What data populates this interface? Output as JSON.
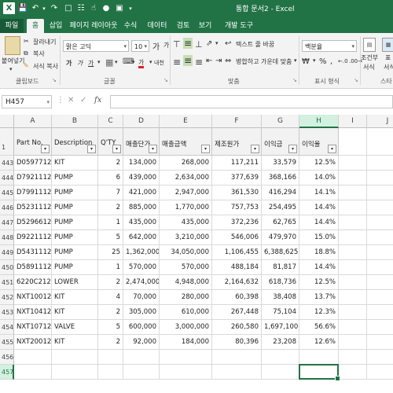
{
  "app": {
    "title": "통합 문서2 - Excel",
    "logo": "X",
    "accent": "#217346",
    "quick_access_icons": [
      "save-icon",
      "undo-icon",
      "redo-icon",
      "new-file-icon",
      "print-preview-icon",
      "touch-mode-icon",
      "color-icon",
      "camera-icon",
      "more-icon"
    ]
  },
  "tabs": [
    "파일",
    "홈",
    "삽입",
    "페이지 레이아웃",
    "수식",
    "데이터",
    "검토",
    "보기",
    "개발 도구"
  ],
  "active_tab": "홈",
  "ribbon": {
    "clipboard": {
      "paste": "붙여넣기",
      "cut": "잘라내기",
      "copy": "복사",
      "format_painter": "서식 복사",
      "group": "클립보드"
    },
    "font": {
      "name": "맑은 고딕",
      "size": "10",
      "grow": "가",
      "shrink": "가",
      "bold": "가",
      "italic": "가",
      "underline": "가",
      "font_color": "가",
      "phonetic": "내천",
      "group": "글꼴"
    },
    "alignment": {
      "wrap_text": "텍스트 줄 바꿈",
      "merge_center": "병합하고 가운데 맞춤",
      "group": "맞춤"
    },
    "number": {
      "format": "백분율",
      "group": "표시 형식"
    },
    "styles": {
      "conditional": "조건부",
      "conditional_sub": "서식",
      "table": "표",
      "table_sub": "서식",
      "group": "스타"
    }
  },
  "name_box": "H457",
  "formula": "",
  "columns": [
    "A",
    "B",
    "C",
    "D",
    "E",
    "F",
    "G",
    "H",
    "I",
    "J"
  ],
  "selected_column": "H",
  "selected_row": "457",
  "header_row": {
    "row": "1",
    "cells": [
      "Part No.",
      "Description",
      "Q'TY",
      "매출단가",
      "매출금액",
      "제조원가",
      "이익금",
      "이익율",
      "",
      ""
    ]
  },
  "rows": [
    {
      "row": "443",
      "cells": [
        "D0597712",
        "KIT",
        "2",
        "134,000",
        "268,000",
        "117,211",
        "33,579",
        "12.5%"
      ]
    },
    {
      "row": "444",
      "cells": [
        "D7921112",
        "PUMP",
        "6",
        "439,000",
        "2,634,000",
        "377,639",
        "368,166",
        "14.0%"
      ]
    },
    {
      "row": "445",
      "cells": [
        "D7991112",
        "PUMP",
        "7",
        "421,000",
        "2,947,000",
        "361,530",
        "416,294",
        "14.1%"
      ]
    },
    {
      "row": "446",
      "cells": [
        "D5231112",
        "PUMP",
        "2",
        "885,000",
        "1,770,000",
        "757,753",
        "254,495",
        "14.4%"
      ]
    },
    {
      "row": "447",
      "cells": [
        "D5296612",
        "PUMP",
        "1",
        "435,000",
        "435,000",
        "372,236",
        "62,765",
        "14.4%"
      ]
    },
    {
      "row": "448",
      "cells": [
        "D9221112",
        "PUMP",
        "5",
        "642,000",
        "3,210,000",
        "546,006",
        "479,970",
        "15.0%"
      ]
    },
    {
      "row": "449",
      "cells": [
        "D5431112",
        "PUMP",
        "25",
        "1,362,000",
        "34,050,000",
        "1,106,455",
        "6,388,625",
        "18.8%"
      ]
    },
    {
      "row": "450",
      "cells": [
        "D5891112",
        "PUMP",
        "1",
        "570,000",
        "570,000",
        "488,184",
        "81,817",
        "14.4%"
      ]
    },
    {
      "row": "451",
      "cells": [
        "6220C212",
        "LOWER",
        "2",
        "2,474,000",
        "4,948,000",
        "2,164,632",
        "618,736",
        "12.5%"
      ]
    },
    {
      "row": "452",
      "cells": [
        "NXT10012",
        "KIT",
        "4",
        "70,000",
        "280,000",
        "60,398",
        "38,408",
        "13.7%"
      ]
    },
    {
      "row": "453",
      "cells": [
        "NXT10412",
        "KIT",
        "2",
        "305,000",
        "610,000",
        "267,448",
        "75,104",
        "12.3%"
      ]
    },
    {
      "row": "454",
      "cells": [
        "NXT10712",
        "VALVE",
        "5",
        "600,000",
        "3,000,000",
        "260,580",
        "1,697,100",
        "56.6%"
      ]
    },
    {
      "row": "455",
      "cells": [
        "NXT20012",
        "KIT",
        "2",
        "92,000",
        "184,000",
        "80,396",
        "23,208",
        "12.6%"
      ]
    },
    {
      "row": "456",
      "cells": [
        "",
        "",
        "",
        "",
        "",
        "",
        "",
        ""
      ]
    },
    {
      "row": "457",
      "cells": [
        "",
        "",
        "",
        "",
        "",
        "",
        "",
        ""
      ]
    }
  ]
}
